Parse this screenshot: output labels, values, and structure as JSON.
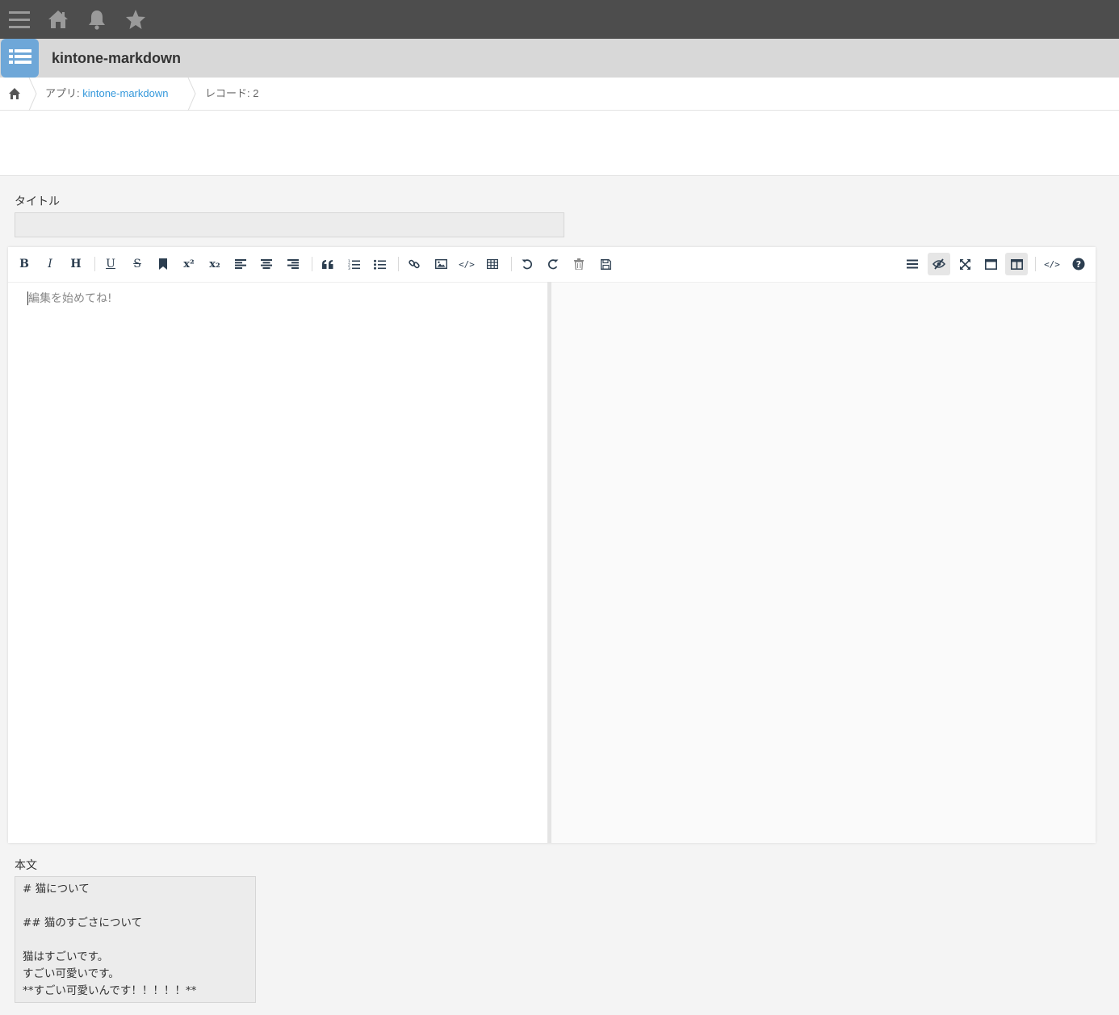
{
  "topbar": {
    "icons": [
      "menu-icon",
      "home-icon",
      "bell-icon",
      "star-icon"
    ]
  },
  "app": {
    "title": "kintone-markdown"
  },
  "breadcrumb": {
    "app_prefix": "アプリ: ",
    "app_name": "kintone-markdown",
    "record": "レコード: 2"
  },
  "fields": {
    "title_label": "タイトル",
    "title_value": "",
    "body_label": "本文",
    "body_lines": [
      "# 猫について",
      "",
      "## 猫のすごさについて",
      "",
      "猫はすごいです。",
      "すごい可愛いです。",
      "**すごい可愛いんです！！！！！**"
    ]
  },
  "editor": {
    "placeholder": "編集を始めてね!",
    "toolbar_left": [
      {
        "name": "bold",
        "label": "B"
      },
      {
        "name": "italic",
        "label": "I"
      },
      {
        "name": "heading",
        "label": "H"
      },
      {
        "name": "underline",
        "label": "U"
      },
      {
        "name": "strikethrough",
        "label": "S"
      },
      {
        "name": "mark",
        "label": ""
      },
      {
        "name": "superscript",
        "label": "x²"
      },
      {
        "name": "subscript",
        "label": "x₂"
      },
      {
        "name": "align-left",
        "label": ""
      },
      {
        "name": "align-center",
        "label": ""
      },
      {
        "name": "align-right",
        "label": ""
      },
      {
        "name": "quote",
        "label": ""
      },
      {
        "name": "ordered-list",
        "label": ""
      },
      {
        "name": "unordered-list",
        "label": ""
      },
      {
        "name": "link",
        "label": ""
      },
      {
        "name": "image",
        "label": ""
      },
      {
        "name": "code",
        "label": "</>"
      },
      {
        "name": "table",
        "label": ""
      },
      {
        "name": "undo",
        "label": ""
      },
      {
        "name": "redo",
        "label": ""
      },
      {
        "name": "trash",
        "label": ""
      },
      {
        "name": "save",
        "label": ""
      }
    ],
    "toolbar_right": [
      {
        "name": "navigation",
        "label": ""
      },
      {
        "name": "preview-toggle",
        "label": "",
        "active": true
      },
      {
        "name": "fullscreen",
        "label": ""
      },
      {
        "name": "read-mode",
        "label": ""
      },
      {
        "name": "subfield",
        "label": "",
        "active": true
      },
      {
        "name": "html-code",
        "label": "</>"
      },
      {
        "name": "help",
        "label": "?"
      }
    ]
  },
  "colors": {
    "topbar": "#4d4d4d",
    "appbar": "#d8d8d8",
    "app_icon": "#6ea7d8",
    "link": "#3498db"
  }
}
